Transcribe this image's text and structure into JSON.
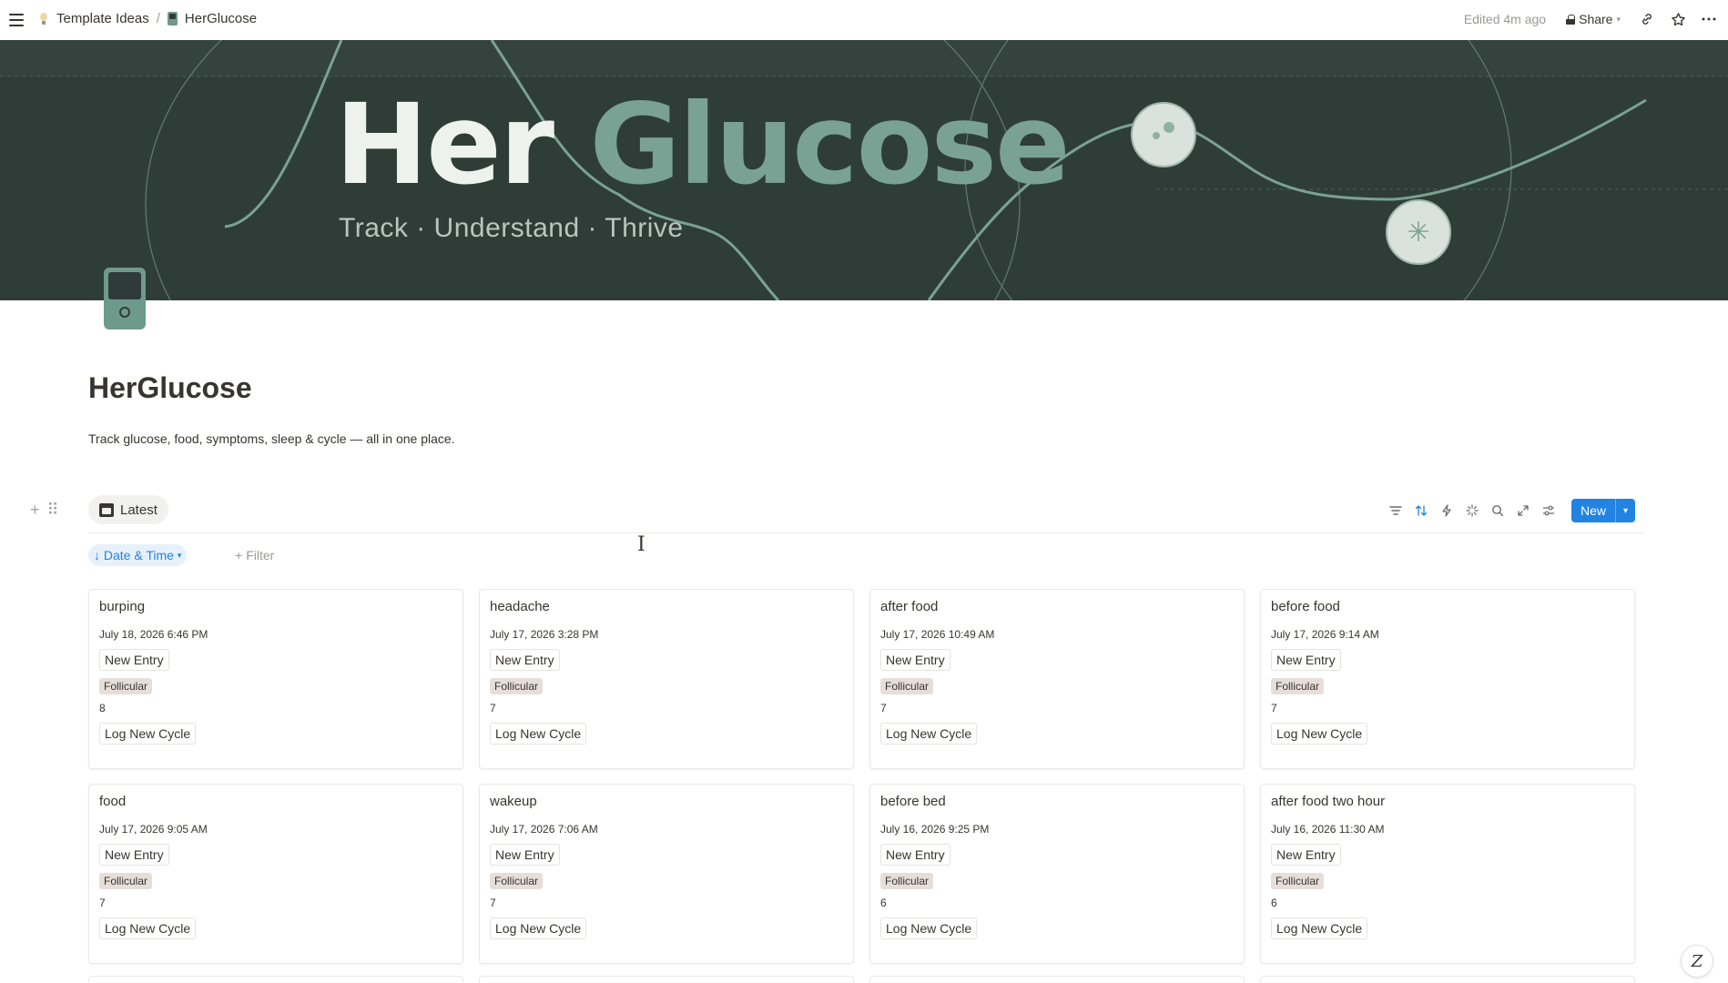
{
  "topbar": {
    "breadcrumbs": [
      {
        "label": "Template Ideas",
        "icon": "lightbulb-icon"
      },
      {
        "label": "HerGlucose",
        "icon": "glucose-meter-icon"
      }
    ],
    "edited": "Edited 4m ago",
    "share_label": "Share"
  },
  "cover": {
    "title_word1": "Her",
    "title_word2": "Glucose",
    "subtitle": "Track · Understand · Thrive"
  },
  "page": {
    "title": "HerGlucose",
    "description": "Track glucose, food, symptoms, sleep & cycle — all in one place."
  },
  "database": {
    "view_label": "Latest",
    "new_label": "New",
    "sort_label": "↓ Date & Time",
    "filter_label": "Filter"
  },
  "cards": [
    {
      "title": "burping",
      "date": "July 18, 2026 6:46 PM",
      "entry": "New Entry",
      "phase": "Follicular",
      "value": "8",
      "cycle": "Log New Cycle"
    },
    {
      "title": "headache",
      "date": "July 17, 2026 3:28 PM",
      "entry": "New Entry",
      "phase": "Follicular",
      "value": "7",
      "cycle": "Log New Cycle"
    },
    {
      "title": "after food",
      "date": "July 17, 2026 10:49 AM",
      "entry": "New Entry",
      "phase": "Follicular",
      "value": "7",
      "cycle": "Log New Cycle"
    },
    {
      "title": "before food",
      "date": "July 17, 2026 9:14 AM",
      "entry": "New Entry",
      "phase": "Follicular",
      "value": "7",
      "cycle": "Log New Cycle"
    },
    {
      "title": "food",
      "date": "July 17, 2026 9:05 AM",
      "entry": "New Entry",
      "phase": "Follicular",
      "value": "7",
      "cycle": "Log New Cycle"
    },
    {
      "title": "wakeup",
      "date": "July 17, 2026 7:06 AM",
      "entry": "New Entry",
      "phase": "Follicular",
      "value": "7",
      "cycle": "Log New Cycle"
    },
    {
      "title": "before bed",
      "date": "July 16, 2026 9:25 PM",
      "entry": "New Entry",
      "phase": "Follicular",
      "value": "6",
      "cycle": "Log New Cycle"
    },
    {
      "title": "after food two hour",
      "date": "July 16, 2026 11:30 AM",
      "entry": "New Entry",
      "phase": "Follicular",
      "value": "6",
      "cycle": "Log New Cycle"
    }
  ],
  "colors": {
    "accent": "#2383e2",
    "cover_bg": "#2f3d38",
    "cover_green": "#7aa294",
    "phase_tag": "#e8ded9"
  }
}
